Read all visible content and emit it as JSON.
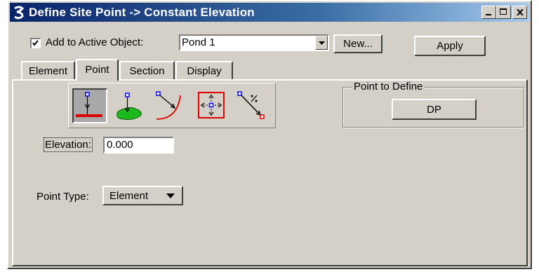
{
  "window": {
    "title": "Define Site Point -> Constant Elevation",
    "title_gradient": [
      "#0a246a",
      "#a6caf0"
    ],
    "face_color": "#d4d0c8"
  },
  "title_buttons": [
    "minimize-icon",
    "maximize-icon",
    "close-icon"
  ],
  "add_to_active": {
    "checked": true,
    "label": "Add to Active Object:",
    "value": "Pond 1"
  },
  "buttons": {
    "new": "New...",
    "apply": "Apply",
    "dp": "DP"
  },
  "tabs": [
    {
      "label": "Element",
      "active": false
    },
    {
      "label": "Point",
      "active": true
    },
    {
      "label": "Section",
      "active": false
    },
    {
      "label": "Display",
      "active": false
    }
  ],
  "tools": [
    {
      "name": "point-on-element-icon",
      "selected": true
    },
    {
      "name": "point-on-surface-icon",
      "selected": false
    },
    {
      "name": "point-on-curve-icon",
      "selected": false
    },
    {
      "name": "point-in-box-icon",
      "selected": false
    },
    {
      "name": "point-slope-icon",
      "selected": false
    }
  ],
  "point_to_define": {
    "title": "Point to Define"
  },
  "elevation": {
    "label": "Elevation:",
    "value": "0.000"
  },
  "point_type": {
    "label": "Point Type:",
    "value": "Element"
  },
  "colors": {
    "accent_red": "#e00000",
    "accent_blue": "#0000ff",
    "surface_green": "#1cba1c"
  }
}
